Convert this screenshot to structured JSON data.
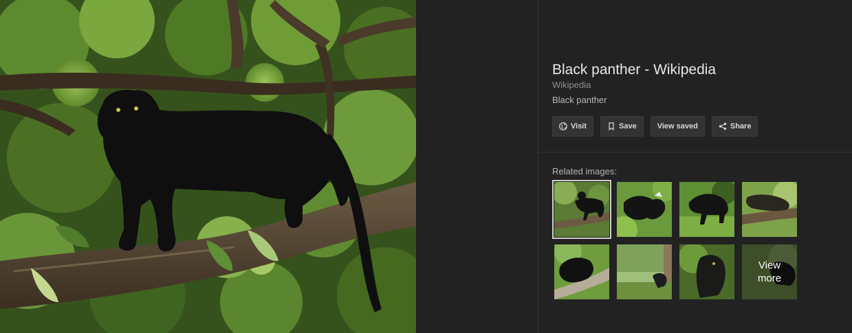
{
  "result": {
    "title": "Black panther - Wikipedia",
    "source": "Wikipedia",
    "caption": "Black panther"
  },
  "actions": {
    "visit": {
      "label": "Visit",
      "icon": "globe-icon"
    },
    "save": {
      "label": "Save",
      "icon": "bookmark-icon"
    },
    "view_saved": {
      "label": "View saved"
    },
    "share": {
      "label": "Share",
      "icon": "share-icon"
    }
  },
  "related": {
    "label": "Related images:",
    "view_more": "View more",
    "thumbnails": [
      {
        "description": "black panther walking on branch",
        "selected": true
      },
      {
        "description": "black panthers playing in grass",
        "selected": false
      },
      {
        "description": "black panther walking on grass",
        "selected": false
      },
      {
        "description": "black panther lying on log",
        "selected": false
      },
      {
        "description": "black panther on tree trunk",
        "selected": false
      },
      {
        "description": "black panther in forest clearing",
        "selected": false
      },
      {
        "description": "black panther in foliage",
        "selected": false
      },
      {
        "description": "black panther behind view more",
        "selected": false
      }
    ]
  },
  "colors": {
    "background": "#222222",
    "button_bg": "#333333",
    "foliage": "#4a6a2a",
    "panther": "#101010"
  }
}
